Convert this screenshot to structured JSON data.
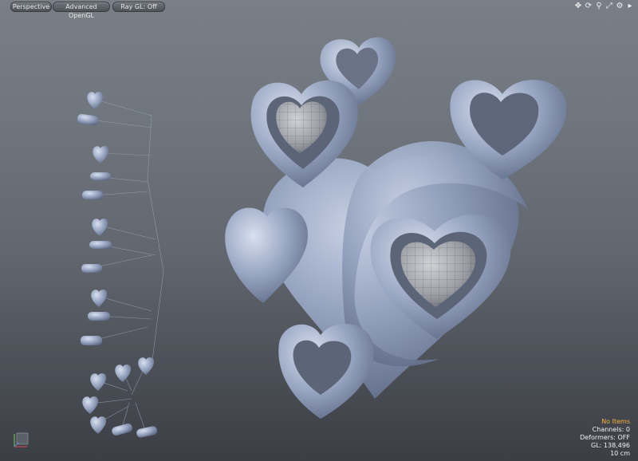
{
  "viewport": {
    "view_label": "Perspective",
    "shading_label": "Advanced OpenGL",
    "raygl_label": "Ray GL: Off"
  },
  "icons": [
    "move-view-icon",
    "rotate-view-icon",
    "zoom-view-icon",
    "maximize-icon",
    "gear-icon",
    "play-icon"
  ],
  "hud": {
    "selection": "No Items",
    "channels": "Channels: 0",
    "deformers": "Deformers: OFF",
    "gl": "GL: 138,496",
    "scale": "10 cm"
  },
  "colors": {
    "background_top": "#7a7f87",
    "background_bottom": "#3b3e44",
    "model": "#8e9cb8",
    "selection_text": "#f4b33e"
  }
}
